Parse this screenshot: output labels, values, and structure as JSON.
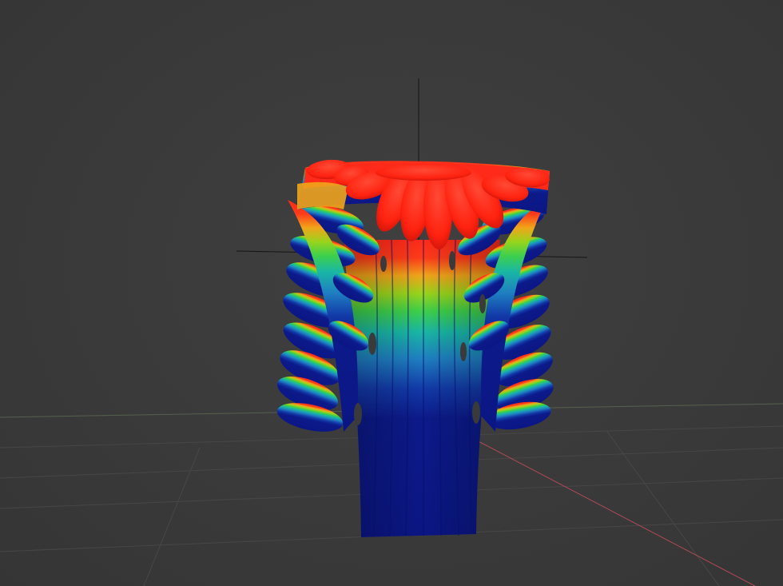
{
  "viewport": {
    "background_color": "#3a3a3a",
    "grid_color": "#4a4a4a",
    "grid_floor_line_color": "#56604e",
    "axis_x_color": "#b04a55",
    "axis_y_color": "#6f8a4c",
    "cursor_color": "#111111",
    "model_colormap": [
      "#0c1a8a",
      "#123aa8",
      "#1f7fc2",
      "#19b7a5",
      "#3ed04a",
      "#9ad41c",
      "#f1a51a",
      "#f0561a",
      "#ff2a1a"
    ],
    "model_icon": "acanthus-leaf-ornament",
    "cursor_icon": "3d-cursor-crosshair"
  }
}
